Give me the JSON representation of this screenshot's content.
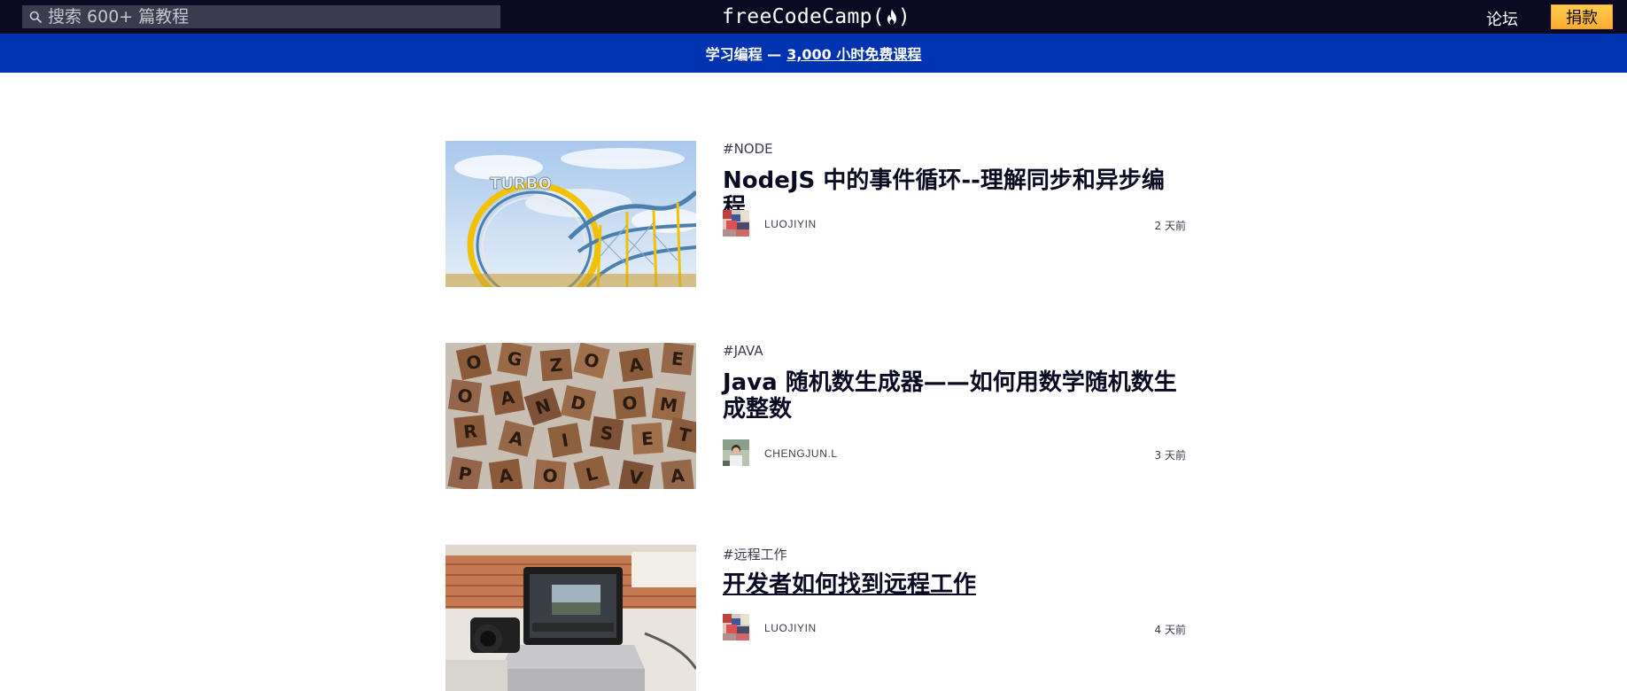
{
  "nav": {
    "search_placeholder": "搜索 600+ 篇教程",
    "brand": "freeCodeCamp(",
    "brand_close": ")",
    "forum": "论坛",
    "donate": "捐款"
  },
  "banner": {
    "prefix": "学习编程 — ",
    "link": "3,000 小时免费课程"
  },
  "posts": [
    {
      "tag": "#NODE",
      "title": "NodeJS 中的事件循环--理解同步和异步编程",
      "author": "LUOJIYIN",
      "time": "2 天前",
      "image": "roller-coaster-photo"
    },
    {
      "tag": "#JAVA",
      "title": "Java 随机数生成器——如何用数学随机数生成整数",
      "author": "CHENGJUN.L",
      "time": "3 天前",
      "image": "scrabble-tiles-photo"
    },
    {
      "tag": "#远程工作",
      "title": "开发者如何找到远程工作",
      "author": "LUOJIYIN",
      "time": "4 天前",
      "image": "laptop-camera-photo"
    }
  ],
  "colors": {
    "nav_bg": "#0a0a23",
    "search_bg": "#3b3b4f",
    "banner_bg": "#0033b0",
    "donate_bg": "#feac32",
    "text": "#0a0a23"
  },
  "icons": {
    "search": "search-icon",
    "brand": "flame-icon"
  }
}
